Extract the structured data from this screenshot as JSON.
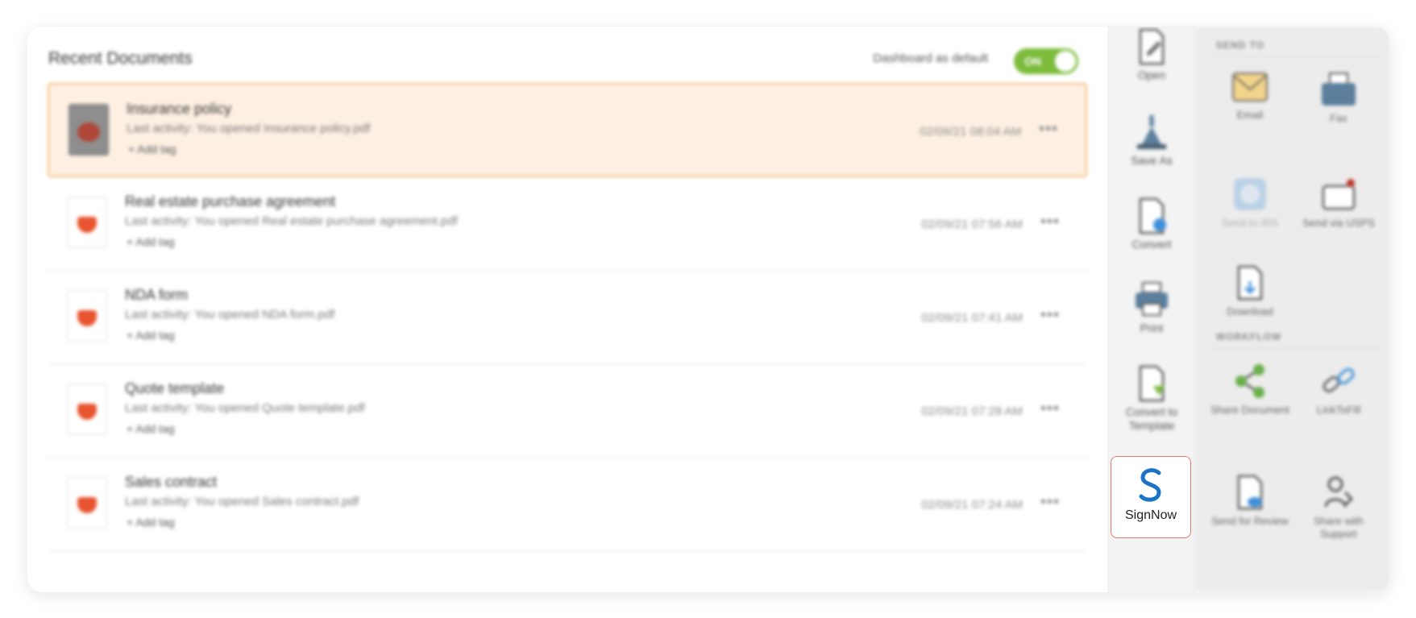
{
  "header": {
    "title": "Recent Documents",
    "toggle_label": "Dashboard as default",
    "toggle_state": "ON"
  },
  "documents": [
    {
      "name": "Insurance policy",
      "activity": "Last activity: You opened Insurance policy.pdf",
      "tag": "+ Add tag",
      "date": "02/09/21 08:04 AM",
      "more": "•••",
      "selected": true
    },
    {
      "name": "Real estate purchase agreement",
      "activity": "Last activity: You opened Real estate purchase agreement.pdf",
      "tag": "+ Add tag",
      "date": "02/09/21 07:56 AM",
      "more": "•••"
    },
    {
      "name": "NDA form",
      "activity": "Last activity: You opened NDA form.pdf",
      "tag": "+ Add tag",
      "date": "02/09/21 07:41 AM",
      "more": "•••"
    },
    {
      "name": "Quote template",
      "activity": "Last activity: You opened Quote template.pdf",
      "tag": "+ Add tag",
      "date": "02/09/21 07:28 AM",
      "more": "•••"
    },
    {
      "name": "Sales contract",
      "activity": "Last activity: You opened Sales contract.pdf",
      "tag": "+ Add tag",
      "date": "02/09/21 07:24 AM",
      "more": "•••"
    }
  ],
  "tools": {
    "open": "Open",
    "save_as": "Save As",
    "convert": "Convert",
    "print": "Print",
    "convert_to_template": "Convert to Template",
    "signnow": "SignNow"
  },
  "send_to": {
    "title": "SEND TO",
    "email": "Email",
    "fax": "Fax",
    "send_to_irs": "Send to IRS",
    "send_via_usps": "Send via USPS",
    "download": "Download"
  },
  "workflow": {
    "title": "WORKFLOW",
    "share_document": "Share Document",
    "linktofill": "LinkToFill",
    "send_for_review": "Send for Review",
    "share_with_support": "Share with Support"
  },
  "colors": {
    "toggle_on": "#7cbb3c",
    "selected_row_bg": "#fdf0e3",
    "selected_row_border": "#f5b97a",
    "signnow_blue": "#1a73c8",
    "signnow_border": "#e27a6a",
    "pdf_red": "#e8542f"
  }
}
